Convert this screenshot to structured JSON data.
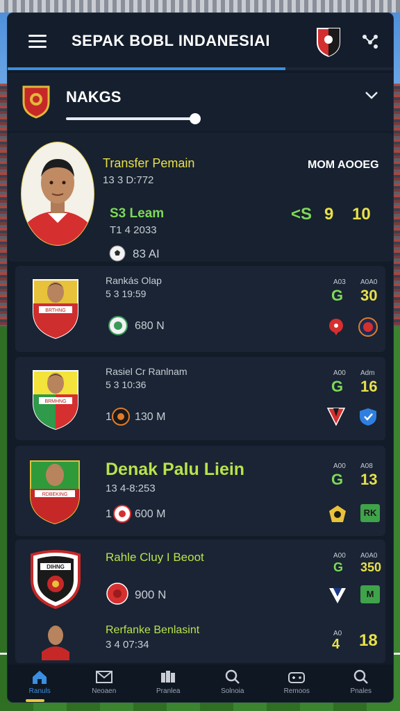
{
  "header": {
    "title": "SEPAK BOBL INDANESIAI",
    "progress": 0.72
  },
  "club": {
    "name": "NAKGS"
  },
  "featured": {
    "title": "Transfer Pemain",
    "subtitle": "13 3 D:772",
    "value_label": "S3 Leam",
    "date": "T1 4 2033",
    "meta": "83 AI",
    "right_label": "MOM AOOEG",
    "stat_symbol": "<S",
    "stat_a": "9",
    "stat_b": "10"
  },
  "cards": [
    {
      "title": "Rankás Olap",
      "time": "5 3 19:59",
      "meta": "680 N",
      "col1_head": "A03",
      "col1_val": "G",
      "col2_head": "A0A0",
      "col2_val": "30",
      "portrait_text": "BRTHNG"
    },
    {
      "title": "Rasiel Cr Ranlnam",
      "time": "5 3 10:36",
      "meta_prefix": "1",
      "meta": "130 M",
      "col1_head": "A00",
      "col1_val": "G",
      "col2_head": "Adm",
      "col2_val": "16",
      "portrait_text": "BRMHNG"
    },
    {
      "title": "Denak Palu Liein",
      "time": "13 4-8:253",
      "meta_prefix": "1",
      "meta": "600 M",
      "col1_head": "A00",
      "col1_val": "G",
      "col2_head": "A08",
      "col2_val": "13",
      "badge": "RK",
      "portrait_text": "RDBEKING"
    },
    {
      "title": "Rahle Cluy I Beoot",
      "time": "",
      "meta": "900 N",
      "col1_head": "A00",
      "col1_val": "G",
      "col2_head": "A0A0",
      "col2_val": "350",
      "badge": "M",
      "crest_text": "DIHNG"
    },
    {
      "title": "Rerfanke Benlasint",
      "time": "3 4 07:34",
      "col1_head": "A0",
      "col1_val": "4",
      "col2_val": "18"
    }
  ],
  "nav": [
    {
      "label": "Ranuls",
      "icon": "home-icon",
      "active": true
    },
    {
      "label": "Neoaen",
      "icon": "mail-icon",
      "active": false
    },
    {
      "label": "Pranlea",
      "icon": "grid-icon",
      "active": false
    },
    {
      "label": "Solnoia",
      "icon": "search-icon",
      "active": false
    },
    {
      "label": "Remoos",
      "icon": "gamepad-icon",
      "active": false
    },
    {
      "label": "Pnales",
      "icon": "search-icon",
      "active": false
    }
  ],
  "colors": {
    "accent": "#3a8fe0",
    "highlight_yellow": "#e9e04a",
    "highlight_green": "#7ed957",
    "panel": "#121b28"
  }
}
